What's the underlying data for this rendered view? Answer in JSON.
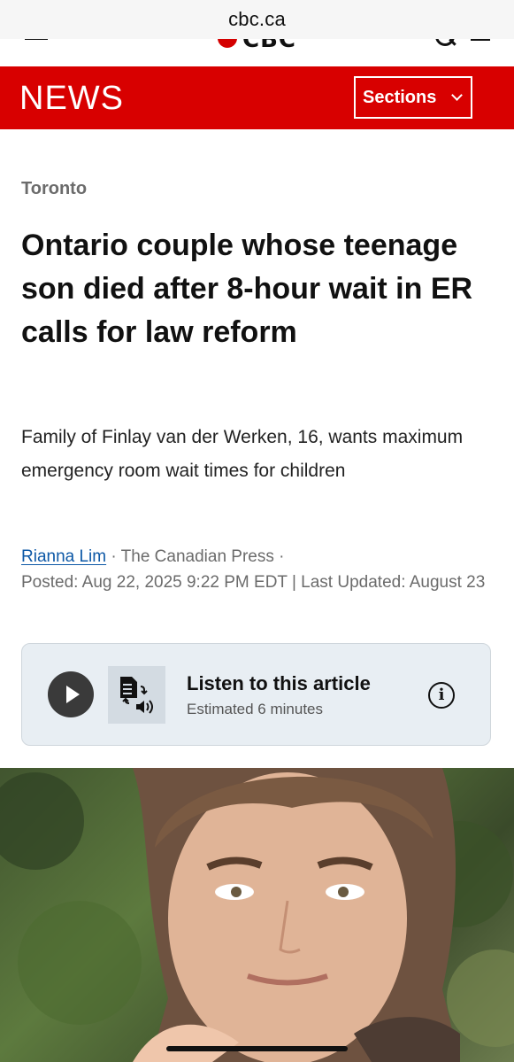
{
  "browser": {
    "url": "cbc.ca"
  },
  "header": {
    "logo_text": "CBC",
    "icons": [
      "menu-icon",
      "cbc-gem-icon",
      "search-icon",
      "account-icon"
    ]
  },
  "news_bar": {
    "title": "NEWS",
    "sections_label": "Sections",
    "color": "#d80000"
  },
  "article": {
    "category": "Toronto",
    "headline": "Ontario couple whose teenage son died after 8-hour wait in ER calls for law reform",
    "deck": "Family of Finlay van der Werken, 16, wants maximum emergency room wait times for children",
    "author": "Rianna Lim",
    "source": " · The Canadian Press ·",
    "posted": "Posted: Aug 22, 2025 9:22 PM EDT | Last Updated: August 23"
  },
  "listen": {
    "title": "Listen to this article",
    "subtitle": "Estimated 6 minutes"
  },
  "photo": {
    "subject": "teen-portrait"
  }
}
